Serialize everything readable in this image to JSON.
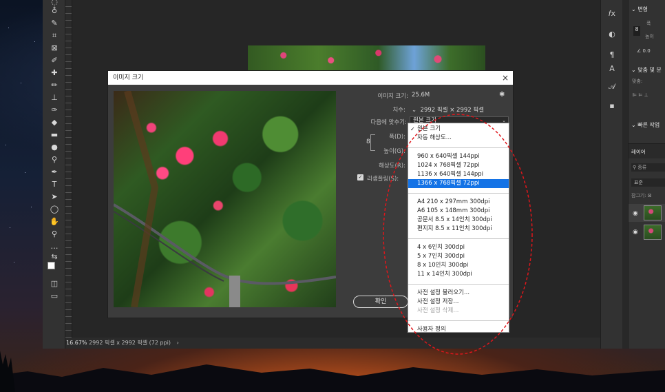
{
  "status_bar": {
    "zoom": "16.67%",
    "doc_info": "2992 픽셀 x 2992 픽셀 (72 ppi)",
    "arrow": "›"
  },
  "panels": {
    "transform_header": "변형",
    "width_short": "폭",
    "height_short": "높이",
    "angle_value": "0.0",
    "align_header": "맞춤 및 분",
    "align_sub": "맞춤:",
    "quick_actions": "빠른 작업",
    "layers_tab": "레이어",
    "search_label": "종류",
    "blend_mode": "표준",
    "lock_label": "잠그기:"
  },
  "dialog": {
    "title": "이미지 크기",
    "close_glyph": "×",
    "image_size_label": "이미지 크기:",
    "image_size_value": "25.6M",
    "dimensions_label": "치수:",
    "dimensions_value": "2992 픽셀  ×  2992 픽셀",
    "fit_to_label": "다음에 맞추기:",
    "fit_to_value": "원본 크기",
    "width_label": "폭(D):",
    "height_label": "높이(G):",
    "resolution_label": "해상도(R):",
    "resample_label": "리샘플링(S):",
    "ok_label": "확인"
  },
  "dropdown": {
    "groups": [
      [
        {
          "label": "원본 크기",
          "checked": true
        },
        {
          "label": "자동 해상도..."
        }
      ],
      [
        {
          "label": "960 x 640픽셀 144ppi"
        },
        {
          "label": "1024 x 768픽셀 72ppi"
        },
        {
          "label": "1136 x 640픽셀 144ppi"
        },
        {
          "label": "1366 x 768픽셀 72ppi",
          "selected": true
        }
      ],
      [
        {
          "label": "A4 210 x 297mm 300dpi"
        },
        {
          "label": "A6 105 x 148mm 300dpi"
        },
        {
          "label": "공문서 8.5 x 14인치 300dpi"
        },
        {
          "label": "편지지 8.5 x 11인치 300dpi"
        }
      ],
      [
        {
          "label": "4 x 6인치 300dpi"
        },
        {
          "label": "5 x 7인치 300dpi"
        },
        {
          "label": "8 x 10인치 300dpi"
        },
        {
          "label": "11 x 14인치 300dpi"
        }
      ],
      [
        {
          "label": "사전 설정 불러오기..."
        },
        {
          "label": "사전 설정 저장..."
        },
        {
          "label": "사전 설정 삭제...",
          "disabled": true
        }
      ],
      [
        {
          "label": "사용자 정의"
        }
      ]
    ]
  },
  "colors": {
    "accent_selection": "#1473e6",
    "annotation_red": "#e0161b",
    "ps_panel": "#323232",
    "ps_canvas": "#262626"
  }
}
